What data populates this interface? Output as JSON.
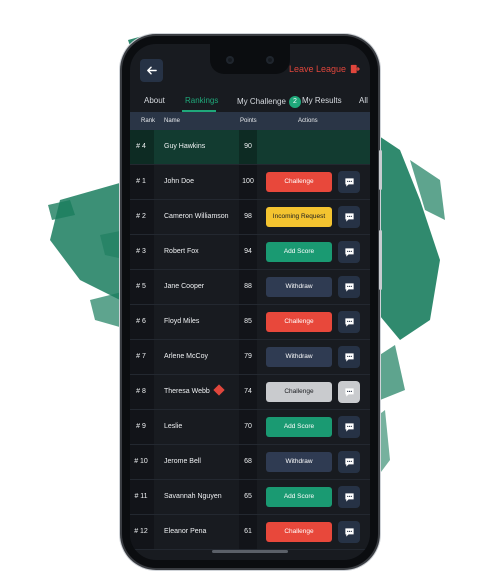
{
  "header": {
    "leave_label": "Leave League"
  },
  "tabs": [
    {
      "label": "About"
    },
    {
      "label": "Rankings",
      "active": true
    },
    {
      "label": "My Challenge",
      "badge": "2"
    },
    {
      "label": "My Results"
    },
    {
      "label": "All"
    }
  ],
  "table": {
    "headers": {
      "rank": "Rank",
      "name": "Name",
      "points": "Points",
      "actions": "Actions"
    }
  },
  "rows": [
    {
      "rank": "# 4",
      "name": "Guy Hawkins",
      "points": "90",
      "action": "",
      "action_type": "none",
      "me": true
    },
    {
      "rank": "# 1",
      "name": "John Doe",
      "points": "100",
      "action": "Challenge",
      "action_type": "challenge"
    },
    {
      "rank": "# 2",
      "name": "Cameron Williamson",
      "points": "98",
      "action": "Incoming Request",
      "action_type": "incoming"
    },
    {
      "rank": "# 3",
      "name": "Robert Fox",
      "points": "94",
      "action": "Add Score",
      "action_type": "add-score"
    },
    {
      "rank": "# 5",
      "name": "Jane Cooper",
      "points": "88",
      "action": "Withdraw",
      "action_type": "withdraw"
    },
    {
      "rank": "# 6",
      "name": "Floyd Miles",
      "points": "85",
      "action": "Challenge",
      "action_type": "challenge"
    },
    {
      "rank": "# 7",
      "name": "Arlene McCoy",
      "points": "79",
      "action": "Withdraw",
      "action_type": "withdraw"
    },
    {
      "rank": "# 8",
      "name": "Theresa Webb",
      "points": "74",
      "action": "Challenge",
      "action_type": "disabled",
      "alert": true
    },
    {
      "rank": "# 9",
      "name": "Leslie",
      "points": "70",
      "action": "Add Score",
      "action_type": "add-score"
    },
    {
      "rank": "# 10",
      "name": "Jerome Bell",
      "points": "68",
      "action": "Withdraw",
      "action_type": "withdraw"
    },
    {
      "rank": "# 11",
      "name": "Savannah Nguyen",
      "points": "65",
      "action": "Add Score",
      "action_type": "add-score"
    },
    {
      "rank": "# 12",
      "name": "Eleanor Pena",
      "points": "61",
      "action": "Challenge",
      "action_type": "challenge"
    }
  ],
  "colors": {
    "challenge": "#e8483b",
    "incoming": "#f4c430",
    "add-score": "#1a9a72",
    "withdraw": "#2f3b52",
    "disabled": "#c9cbce",
    "accent": "#1fa87a",
    "leave": "#e0463c"
  }
}
